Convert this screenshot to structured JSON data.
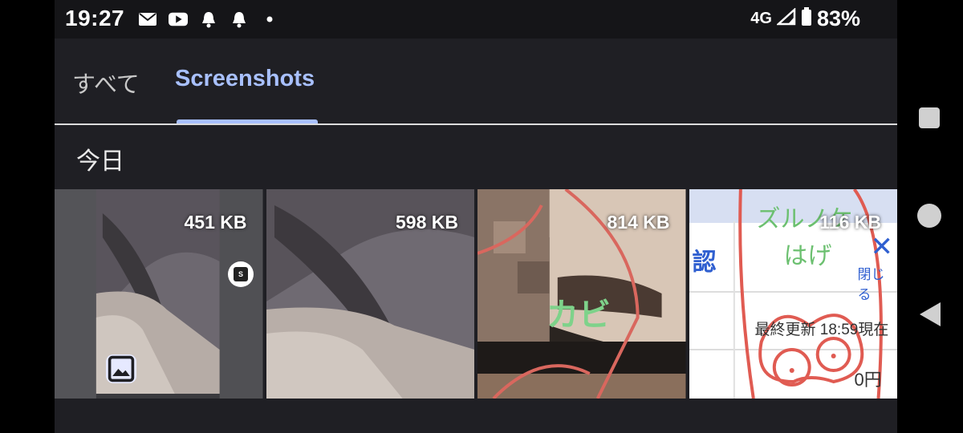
{
  "status_bar": {
    "time": "19:27",
    "left_icons": [
      "au-mail-icon",
      "youtube-icon",
      "bell-icon",
      "bell-icon",
      "dot-icon"
    ],
    "network": "4G",
    "battery": "83%"
  },
  "tabs": [
    {
      "label": "すべて",
      "active": false
    },
    {
      "label": "Screenshots",
      "active": true
    }
  ],
  "section_title": "今日",
  "thumbnails": [
    {
      "size": "451 KB",
      "badges": [
        "image-icon",
        "screenshot-s-icon"
      ]
    },
    {
      "size": "598 KB"
    },
    {
      "size": "814 KB",
      "overlay_text": "カビ"
    },
    {
      "size": "116 KB",
      "overlay_text": [
        "ズルノケ",
        "はげ"
      ],
      "page_text": {
        "heading": "認",
        "close_label": "閉じる",
        "updated": "最終更新 18:59現在",
        "price": "0円"
      }
    }
  ],
  "colors": {
    "accent": "#a8c0ff",
    "background": "#1f1f24"
  },
  "nav_bar": [
    "recents-square-icon",
    "home-circle-icon",
    "back-triangle-icon"
  ]
}
